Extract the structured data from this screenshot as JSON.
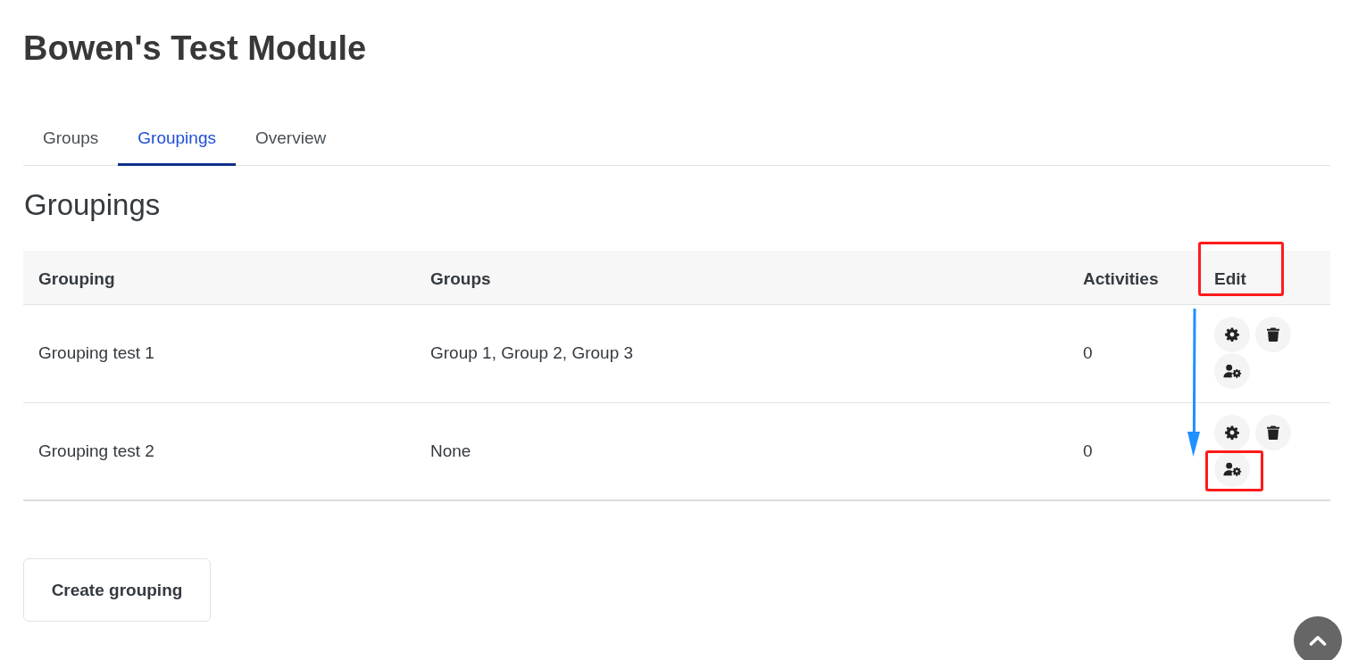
{
  "page": {
    "title": "Bowen's Test Module"
  },
  "tabs": [
    {
      "label": "Groups",
      "selected": false
    },
    {
      "label": "Groupings",
      "selected": true
    },
    {
      "label": "Overview",
      "selected": false
    }
  ],
  "section": {
    "heading": "Groupings"
  },
  "table": {
    "columns": [
      {
        "label": "Grouping",
        "highlighted": false
      },
      {
        "label": "Groups",
        "highlighted": false
      },
      {
        "label": "Activities",
        "highlighted": false
      },
      {
        "label": "Edit",
        "highlighted": true
      }
    ],
    "rows": [
      {
        "grouping": "Grouping test 1",
        "groups": "Group 1, Group 2, Group 3",
        "activities": "0",
        "actions": [
          {
            "kind": "settings",
            "highlighted": false
          },
          {
            "kind": "delete",
            "highlighted": false
          },
          {
            "kind": "members",
            "highlighted": false
          }
        ]
      },
      {
        "grouping": "Grouping test 2",
        "groups": "None",
        "activities": "0",
        "actions": [
          {
            "kind": "settings",
            "highlighted": false
          },
          {
            "kind": "delete",
            "highlighted": false
          },
          {
            "kind": "members",
            "highlighted": true
          }
        ]
      }
    ]
  },
  "annotations": [
    {
      "kind": "arrow"
    }
  ],
  "create_button": {
    "label": "Create grouping"
  }
}
